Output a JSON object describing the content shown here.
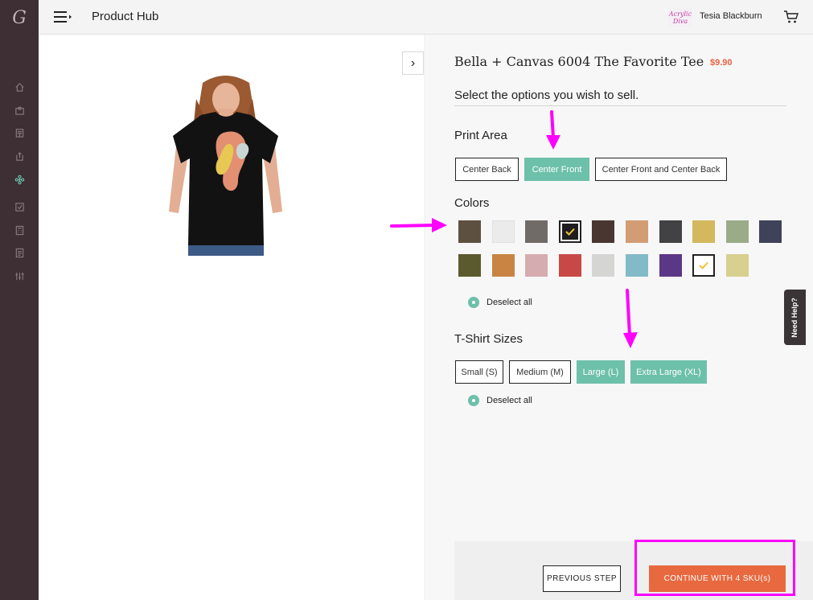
{
  "app": {
    "logo_letter": "G",
    "title": "Product Hub",
    "brand_logo_text": "Acrylic Diva",
    "user_name": "Tesia Blackburn"
  },
  "sidebar": {
    "items": [
      {
        "icon": "home-icon",
        "active": false
      },
      {
        "icon": "portfolio-icon",
        "active": false
      },
      {
        "icon": "storefront-icon",
        "active": false
      },
      {
        "icon": "upload-icon",
        "active": false
      },
      {
        "icon": "products-icon",
        "active": true
      },
      {
        "icon": "orders-icon",
        "active": false
      },
      {
        "icon": "calculator-icon",
        "active": false
      },
      {
        "icon": "reports-icon",
        "active": false
      },
      {
        "icon": "settings-sliders-icon",
        "active": false
      }
    ],
    "active_color": "#6dc0aa"
  },
  "product": {
    "name": "Bella + Canvas 6004 The Favorite Tee",
    "price": "$9.90",
    "instructions": "Select the options you wish to sell."
  },
  "print_area": {
    "title": "Print Area",
    "options": [
      {
        "label": "Center Back",
        "selected": false
      },
      {
        "label": "Center Front",
        "selected": true
      },
      {
        "label": "Center Front and Center Back",
        "selected": false
      }
    ]
  },
  "colors": {
    "title": "Colors",
    "swatches": [
      {
        "color": "#5e5040",
        "selected": false
      },
      {
        "color": "#ebebeb",
        "selected": false
      },
      {
        "color": "#716b68",
        "selected": false
      },
      {
        "color": "#1f1d1d",
        "selected": true
      },
      {
        "color": "#4a3631",
        "selected": false
      },
      {
        "color": "#d29c75",
        "selected": false
      },
      {
        "color": "#424245",
        "selected": false
      },
      {
        "color": "#d3b85d",
        "selected": false
      },
      {
        "color": "#9aab88",
        "selected": false
      },
      {
        "color": "#40425a",
        "selected": false
      },
      {
        "color": "#5b5a2e",
        "selected": false
      },
      {
        "color": "#c98444",
        "selected": false
      },
      {
        "color": "#d5acb0",
        "selected": false
      },
      {
        "color": "#c84846",
        "selected": false
      },
      {
        "color": "#d5d5d3",
        "selected": false
      },
      {
        "color": "#82bac7",
        "selected": false
      },
      {
        "color": "#5b3787",
        "selected": false
      },
      {
        "color": "#ffffff",
        "selected": true
      },
      {
        "color": "#d8d08f",
        "selected": false
      }
    ],
    "check_color": "#f0c238",
    "deselect_label": "Deselect all"
  },
  "sizes": {
    "title": "T-Shirt Sizes",
    "options": [
      {
        "label": "Small (S)",
        "selected": false
      },
      {
        "label": "Medium (M)",
        "selected": false
      },
      {
        "label": "Large (L)",
        "selected": true
      },
      {
        "label": "Extra Large (XL)",
        "selected": true
      }
    ],
    "deselect_label": "Deselect all"
  },
  "actions": {
    "previous_label": "PREVIOUS STEP",
    "continue_label": "CONTINUE WITH 4 SKU(s)"
  },
  "help": {
    "label": "Need Help?"
  },
  "annotations": {
    "arrow_color": "#ff00ff",
    "arrows": [
      "arrow-to-center-front",
      "arrow-to-colors",
      "arrow-to-large-size"
    ],
    "highlight": "continue-button"
  }
}
